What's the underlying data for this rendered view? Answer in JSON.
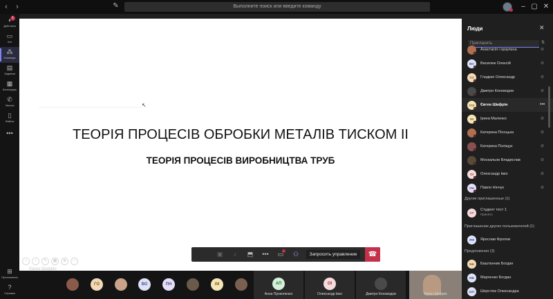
{
  "titlebar": {
    "back": "‹",
    "forward": "›",
    "search_placeholder": "Выполните поиск или введите команду",
    "minimize": "–",
    "maximize": "▢",
    "close": "✕"
  },
  "rail": {
    "items": [
      {
        "label": "Действия",
        "icon": "◗",
        "badge": "1"
      },
      {
        "label": "Чат",
        "icon": "▭"
      },
      {
        "label": "Команды",
        "icon": "⁂"
      },
      {
        "label": "Задания",
        "icon": "▤"
      },
      {
        "label": "Календарь",
        "icon": "▦"
      },
      {
        "label": "Звонки",
        "icon": "✆"
      },
      {
        "label": "Файлы",
        "icon": "▯"
      },
      {
        "label": "",
        "icon": "•••"
      }
    ],
    "apps": {
      "label": "Приложения",
      "icon": "⊞"
    },
    "help": {
      "label": "Справка",
      "icon": "?"
    }
  },
  "slide": {
    "title": "ТЕОРІЯ ПРОЦЕСІВ ОБРОБКИ МЕТАЛІВ ТИСКОМ ІІ",
    "subtitle": "ТЕОРІЯ ПРОЦЕСІВ ВИРОБНИЦТВА ТРУБ",
    "presenter": "Євген Шифрін"
  },
  "controls": {
    "timer": "",
    "request_control": "Запросить управление"
  },
  "strip": {
    "avatars": [
      {
        "initials": "",
        "bg": "#8a5a4a"
      },
      {
        "initials": "ГО",
        "bg": "#f2d9b8",
        "fg": "#8a5a1f"
      },
      {
        "initials": "",
        "bg": "#c9a38a"
      },
      {
        "initials": "ВО",
        "bg": "#dfe3f5",
        "fg": "#4a55a0"
      },
      {
        "initials": "ПН",
        "bg": "#e6dff5",
        "fg": "#5a4a90"
      },
      {
        "initials": "",
        "bg": "#6a5a4a"
      },
      {
        "initials": "ІМ",
        "bg": "#f5e6b8",
        "fg": "#8a6a1a"
      },
      {
        "initials": "",
        "bg": "#7a6050"
      }
    ],
    "tiles": [
      {
        "initials": "АП",
        "name": "Анна Прокопенко",
        "bg": "#d6f0dc",
        "fg": "#2a7a3a"
      },
      {
        "initials": "ОІ",
        "name": "Олександр Івко",
        "bg": "#f5dcdc",
        "fg": "#a03030"
      },
      {
        "initials": "",
        "name": "Дмитро Коноводов",
        "bg": "#4a4a4a",
        "fg": "#fff"
      },
      {
        "initials": "",
        "name": "Євген Шифрін",
        "bg": "#b89a82",
        "fg": "#fff"
      }
    ]
  },
  "panel": {
    "title": "Люди",
    "invite_placeholder": "Пригласить",
    "participants": [
      {
        "initials": "",
        "name": "Анастасія і орзулєна",
        "bg": "#b07050"
      },
      {
        "initials": "ВО",
        "name": "Василюк Олексій",
        "bg": "#dfe3f5",
        "fg": "#4a55a0"
      },
      {
        "initials": "ГО",
        "name": "Гладких Олександр",
        "bg": "#f2d9b8",
        "fg": "#8a5a1f"
      },
      {
        "initials": "",
        "name": "Дмитро Коноводов",
        "bg": "#4a4a4a"
      },
      {
        "initials": "ЄШ",
        "name": "Євген Шифрін",
        "bg": "#f5e6b8",
        "fg": "#8a6a1a",
        "selected": true
      },
      {
        "initials": "ІМ",
        "name": "Ірина Маленко",
        "bg": "#f5e6b8",
        "fg": "#8a6a1a"
      },
      {
        "initials": "",
        "name": "Катерина Пісоцька",
        "bg": "#b07050"
      },
      {
        "initials": "",
        "name": "Катерина Поліщук",
        "bg": "#8a5050"
      },
      {
        "initials": "",
        "name": "Москальов Владислав",
        "bg": "#5a4a3a"
      },
      {
        "initials": "ОІ",
        "name": "Олександр Івко",
        "bg": "#f5dcdc",
        "fg": "#a03030"
      },
      {
        "initials": "ПН",
        "name": "Павло Нінчук",
        "bg": "#e6dff5",
        "fg": "#5a4a90"
      }
    ],
    "section_other": "Другие приглашенные (1)",
    "other": {
      "initials": "СТ",
      "name": "Студент тест 1",
      "sub": "Принято",
      "bg": "#f5dcdc",
      "fg": "#a03030"
    },
    "section_invites": "Приглашение других пользователей (1)",
    "invites": [
      {
        "initials": "ЯФ",
        "name": "Ярослав Фролов",
        "bg": "#dfe3f5",
        "fg": "#4a55a0"
      }
    ],
    "section_suggest": "Предложения (3)",
    "suggest": [
      {
        "initials": "ББ",
        "name": "Баштанник Богдан",
        "bg": "#f2d9b8",
        "fg": "#8a5a1f"
      },
      {
        "initials": "МБ",
        "name": "Марченко Богдан",
        "bg": "#dfe3f5",
        "fg": "#4a55a0"
      },
      {
        "initials": "ШО",
        "name": "Шерстюк Олександра",
        "bg": "#dfe3f5",
        "fg": "#4a55a0"
      }
    ]
  }
}
